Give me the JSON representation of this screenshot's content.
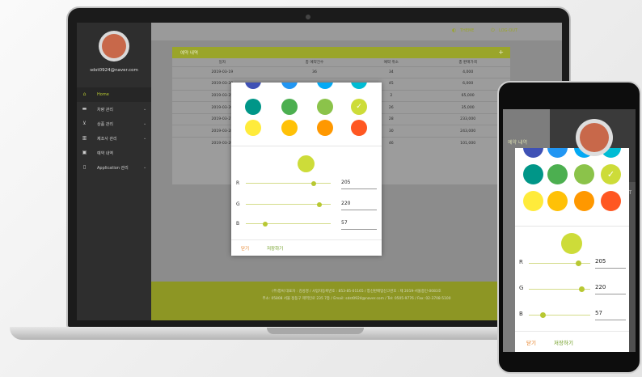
{
  "laptop": {
    "email": "sdst0924@naver.com",
    "nav": [
      {
        "label": "Home",
        "icon": "home-icon",
        "glyph": "⌂",
        "active": true,
        "chevron": ""
      },
      {
        "label": "차량 관리",
        "icon": "car-icon",
        "glyph": "▬",
        "active": false,
        "chevron": "⌄"
      },
      {
        "label": "상품 관리",
        "icon": "cart-icon",
        "glyph": "⊻",
        "active": false,
        "chevron": "⌄"
      },
      {
        "label": "제조사 관리",
        "icon": "bar-chart-icon",
        "glyph": "▥",
        "active": false,
        "chevron": "⌄"
      },
      {
        "label": "예약 내역",
        "icon": "calendar-icon",
        "glyph": "▣",
        "active": false,
        "chevron": ""
      },
      {
        "label": "Application 관리",
        "icon": "mobile-icon",
        "glyph": "▯",
        "active": false,
        "chevron": "⌄"
      }
    ],
    "topbar": {
      "theme_label": "THEME",
      "logout_label": "LOG-OUT"
    },
    "card": {
      "title": "예약 내역",
      "plus": "+",
      "columns": [
        "일자",
        "총 예약건수",
        "예약 취소",
        "총 판매가격"
      ],
      "rows": [
        [
          "2019-03-19",
          "36",
          "34",
          "4,000"
        ],
        [
          "2019-03-20",
          "",
          "45",
          "6,000"
        ],
        [
          "2019-03-25",
          "",
          "2",
          "65,000"
        ],
        [
          "2019-03-26",
          "",
          "26",
          "35,000"
        ],
        [
          "2019-03-27",
          "",
          "28",
          "233,000"
        ],
        [
          "2019-03-28",
          "",
          "30",
          "243,000"
        ],
        [
          "2019-03-29",
          "",
          "46",
          "101,000"
        ]
      ]
    },
    "footer": {
      "line1": "(주)통써 대표자 : 김성경 / 사업자등록번호 : 853-85-01165 / 통신판매업신고번호 : 제 2019-서울중인-0083호",
      "line2": "주소: 05808 서울 정동구 제역인로 235 7층 / Email: sdst0924@naver.com / Tel: 0505-9776 / Fax: 02-3708-5100"
    }
  },
  "color_picker": {
    "swatches": [
      {
        "color": "#3f51b5",
        "checked": false
      },
      {
        "color": "#2196f3",
        "checked": false
      },
      {
        "color": "#03a9f4",
        "checked": false
      },
      {
        "color": "#00bcd4",
        "checked": false
      },
      {
        "color": "#009688",
        "checked": false
      },
      {
        "color": "#4caf50",
        "checked": false
      },
      {
        "color": "#8bc34a",
        "checked": false
      },
      {
        "color": "#cddc39",
        "checked": true
      },
      {
        "color": "#ffeb3b",
        "checked": false
      },
      {
        "color": "#ffc107",
        "checked": false
      },
      {
        "color": "#ff9800",
        "checked": false
      },
      {
        "color": "#ff5722",
        "checked": false
      }
    ],
    "preview_color": "#cddc39",
    "channels": [
      {
        "label": "R",
        "value": "205",
        "fraction": 0.804
      },
      {
        "label": "G",
        "value": "220",
        "fraction": 0.863
      },
      {
        "label": "B",
        "value": "57",
        "fraction": 0.224
      }
    ],
    "close_label": "닫기",
    "save_label": "저장하기"
  },
  "phone": {
    "bg_title": "예약 내역",
    "edge_text": "UT"
  },
  "colors": {
    "accent": "#b8c832",
    "header_green": "#9aa52a",
    "close_orange": "#e67e22",
    "save_green": "#6a9a1a"
  }
}
